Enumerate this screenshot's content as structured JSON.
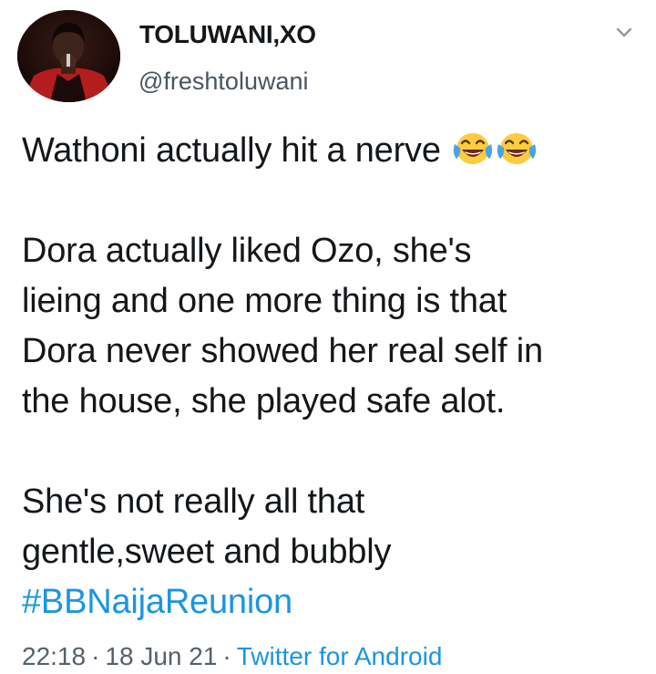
{
  "tweet": {
    "author": {
      "display_name": "TOLUWANI,XO",
      "handle": "@freshtoluwani",
      "avatar_icon": "profile-photo"
    },
    "menu_icon": "chevron-down-icon",
    "lines": [
      "Wathoni actually hit a nerve",
      "",
      "Dora actually liked Ozo, she's",
      "lieing and one more thing is that",
      "Dora never showed her real self in",
      "the house, she played safe alot.",
      "",
      "She's not really all that",
      "gentle,sweet and bubbly"
    ],
    "emoji": [
      "face-with-tears-of-joy",
      "face-with-tears-of-joy"
    ],
    "hashtag": "#BBNaijaReunion",
    "time": "22:18",
    "separator": "·",
    "date": "18 Jun 21",
    "source": "Twitter for Android"
  },
  "colors": {
    "text": "#14171a",
    "secondary": "#55606b",
    "link": "#1b95e0",
    "background": "#ffffff"
  }
}
